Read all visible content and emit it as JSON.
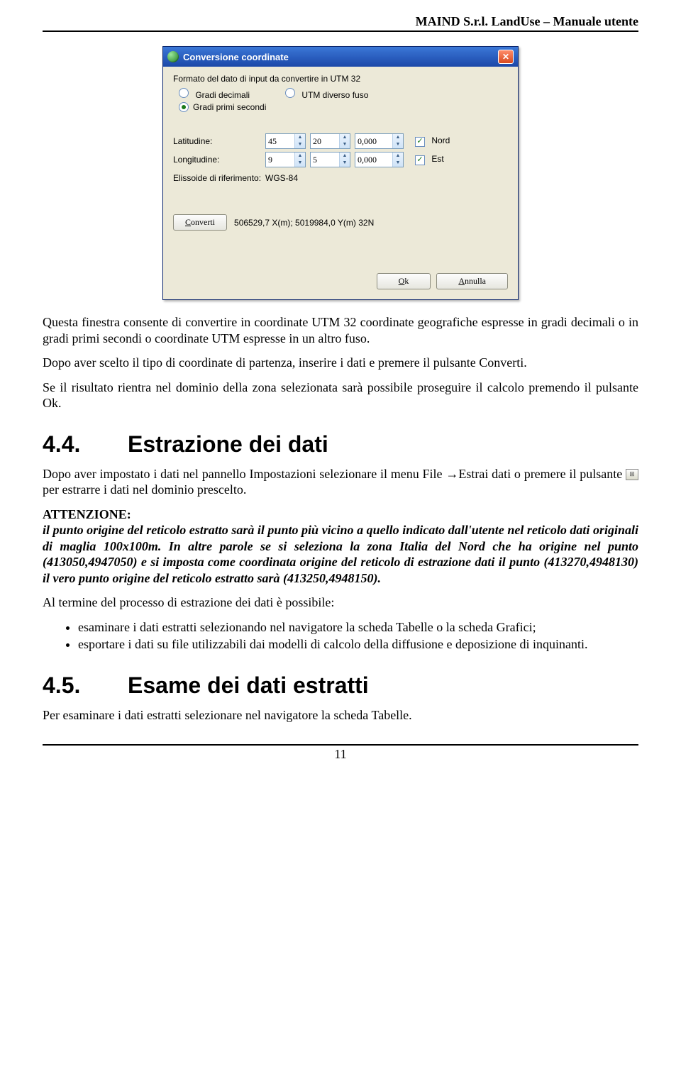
{
  "header": "MAIND S.r.l. LandUse – Manuale utente",
  "dialog": {
    "title": "Conversione coordinate",
    "format_label": "Formato del dato di input da convertire in UTM 32",
    "radio_gradi_decimali": "Gradi decimali",
    "radio_utm": "UTM diverso fuso",
    "radio_gps": "Gradi primi secondi",
    "lat_label": "Latitudine:",
    "lat_deg": "45",
    "lat_min": "20",
    "lat_sec": "0,000",
    "nord": "Nord",
    "lon_label": "Longitudine:",
    "lon_deg": "9",
    "lon_min": "5",
    "lon_sec": "0,000",
    "est": "Est",
    "ellipsoid_label": "Elissoide di riferimento:",
    "ellipsoid_value": "WGS-84",
    "convert_btn": "Converti",
    "result": "506529,7 X(m); 5019984,0 Y(m) 32N",
    "ok_btn": "Ok",
    "cancel_btn": "Annulla"
  },
  "p1": "Questa finestra consente di convertire in coordinate UTM 32 coordinate geografiche espresse in gradi decimali o in gradi primi secondi o coordinate UTM espresse in un altro fuso.",
  "p2": "Dopo aver scelto il tipo di coordinate di partenza, inserire i dati e premere il pulsante Converti.",
  "p3": "Se il risultato rientra nel dominio della zona selezionata sarà possibile proseguire il calcolo premendo il pulsante Ok.",
  "sec44_num": "4.4.",
  "sec44_title": "Estrazione dei dati",
  "p4a": "Dopo aver impostato i dati nel pannello Impostazioni selezionare il menu File ",
  "p4b": "Estrai dati o premere il pulsante ",
  "p4c": " per estrarre i dati nel dominio prescelto.",
  "att_label": "ATTENZIONE:",
  "att_body": "il punto origine del reticolo estratto sarà il punto più vicino a quello indicato dall'utente nel reticolo dati originali di maglia 100x100m. In altre parole se si seleziona la zona Italia del Nord che ha origine nel punto (413050,4947050) e si imposta come coordinata origine del reticolo di estrazione dati il punto (413270,4948130) il vero punto origine del reticolo estratto sarà (413250,4948150).",
  "p5": "Al termine del processo di estrazione dei dati è possibile:",
  "bul1": "esaminare i dati estratti selezionando nel navigatore la scheda Tabelle o la scheda Grafici;",
  "bul2": "esportare i dati su file utilizzabili dai modelli di calcolo della diffusione e deposizione di inquinanti.",
  "sec45_num": "4.5.",
  "sec45_title": "Esame dei dati estratti",
  "p6": "Per esaminare i dati estratti selezionare nel navigatore la scheda Tabelle.",
  "page_number": "11"
}
